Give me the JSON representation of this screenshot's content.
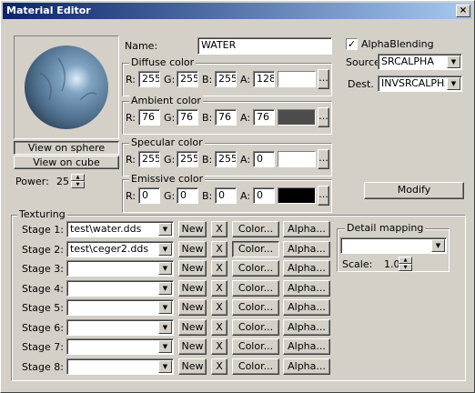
{
  "window": {
    "title": "Material Editor",
    "close_icon": "×"
  },
  "preview": {
    "view_sphere": "View on sphere",
    "view_cube": "View on cube",
    "power_label": "Power:",
    "power_value": "25"
  },
  "name": {
    "label": "Name:",
    "value": "WATER"
  },
  "blend": {
    "alpha_label": "AlphaBlending",
    "alpha_checked": true,
    "source_label": "Source",
    "source_value": "SRCALPHA",
    "dest_label": "Dest.",
    "dest_value": "INVSRCALPHA"
  },
  "colors": [
    {
      "title": "Diffuse color",
      "r": "255",
      "g": "255",
      "b": "255",
      "a": "128",
      "swatch": "#ffffff"
    },
    {
      "title": "Ambient color",
      "r": "76",
      "g": "76",
      "b": "76",
      "a": "76",
      "swatch": "#4c4c4c"
    },
    {
      "title": "Specular color",
      "r": "255",
      "g": "255",
      "b": "255",
      "a": "0",
      "swatch": "#ffffff"
    },
    {
      "title": "Emissive color",
      "r": "0",
      "g": "0",
      "b": "0",
      "a": "0",
      "swatch": "#000000"
    }
  ],
  "color_labels": {
    "r": "R:",
    "g": "G:",
    "b": "B:",
    "a": "A:",
    "more": "..."
  },
  "modify_label": "Modify",
  "texturing": {
    "title": "Texturing",
    "new_label": "New",
    "x_label": "X",
    "color_label": "Color...",
    "alpha_label": "Alpha...",
    "stages": [
      {
        "label": "Stage 1:",
        "file": "test\\water.dds"
      },
      {
        "label": "Stage 2:",
        "file": "test\\ceger2.dds"
      },
      {
        "label": "Stage 3:",
        "file": ""
      },
      {
        "label": "Stage 4:",
        "file": ""
      },
      {
        "label": "Stage 5:",
        "file": ""
      },
      {
        "label": "Stage 6:",
        "file": ""
      },
      {
        "label": "Stage 7:",
        "file": ""
      },
      {
        "label": "Stage 8:",
        "file": ""
      }
    ]
  },
  "detail": {
    "title": "Detail mapping",
    "value": "",
    "scale_label": "Scale:",
    "scale_value": "1.0"
  }
}
